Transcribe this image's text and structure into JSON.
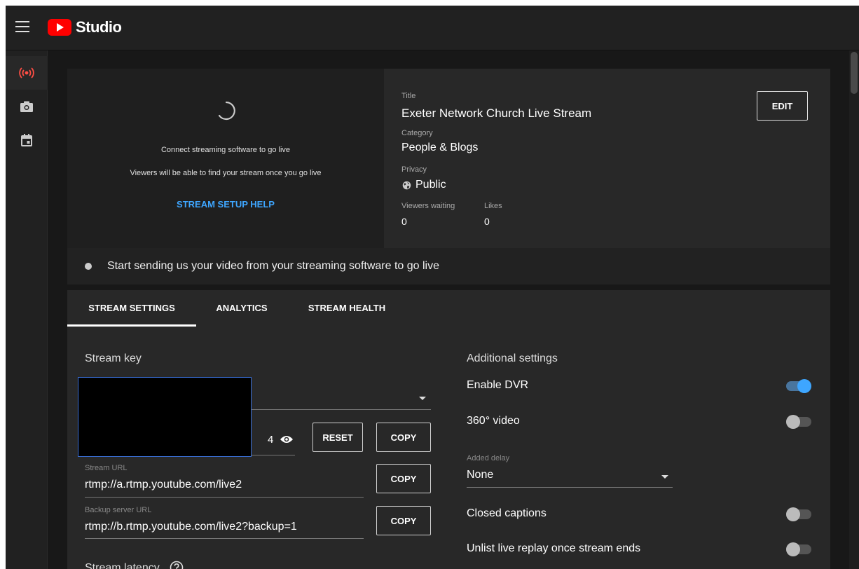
{
  "app": {
    "logo_text": "Studio"
  },
  "preview": {
    "line1": "Connect streaming software to go live",
    "line2": "Viewers will be able to find your stream once you go live",
    "help_link": "STREAM SETUP HELP"
  },
  "info": {
    "title_label": "Title",
    "title_value": "Exeter Network Church Live Stream",
    "category_label": "Category",
    "category_value": "People & Blogs",
    "privacy_label": "Privacy",
    "privacy_value": "Public",
    "viewers_label": "Viewers waiting",
    "viewers_value": "0",
    "likes_label": "Likes",
    "likes_value": "0",
    "edit_label": "EDIT"
  },
  "status": {
    "text": "Start sending us your video from your streaming software to go live"
  },
  "tabs": [
    {
      "label": "STREAM SETTINGS"
    },
    {
      "label": "ANALYTICS"
    },
    {
      "label": "STREAM HEALTH"
    }
  ],
  "stream": {
    "key_title": "Stream key",
    "key_suffix": "4",
    "reset_label": "RESET",
    "copy_label": "COPY",
    "url_label": "Stream URL",
    "url_value": "rtmp://a.rtmp.youtube.com/live2",
    "backup_label": "Backup server URL",
    "backup_value": "rtmp://b.rtmp.youtube.com/live2?backup=1",
    "latency_title": "Stream latency"
  },
  "additional": {
    "title": "Additional settings",
    "dvr_label": "Enable DVR",
    "dvr_on": true,
    "video360_label": "360° video",
    "video360_on": false,
    "delay_label": "Added delay",
    "delay_value": "None",
    "captions_label": "Closed captions",
    "captions_on": false,
    "unlist_label": "Unlist live replay once stream ends",
    "unlist_on": false
  },
  "colors": {
    "accent": "#3ea6ff",
    "brand": "#ff0000",
    "live_icon": "#ff4e45"
  }
}
